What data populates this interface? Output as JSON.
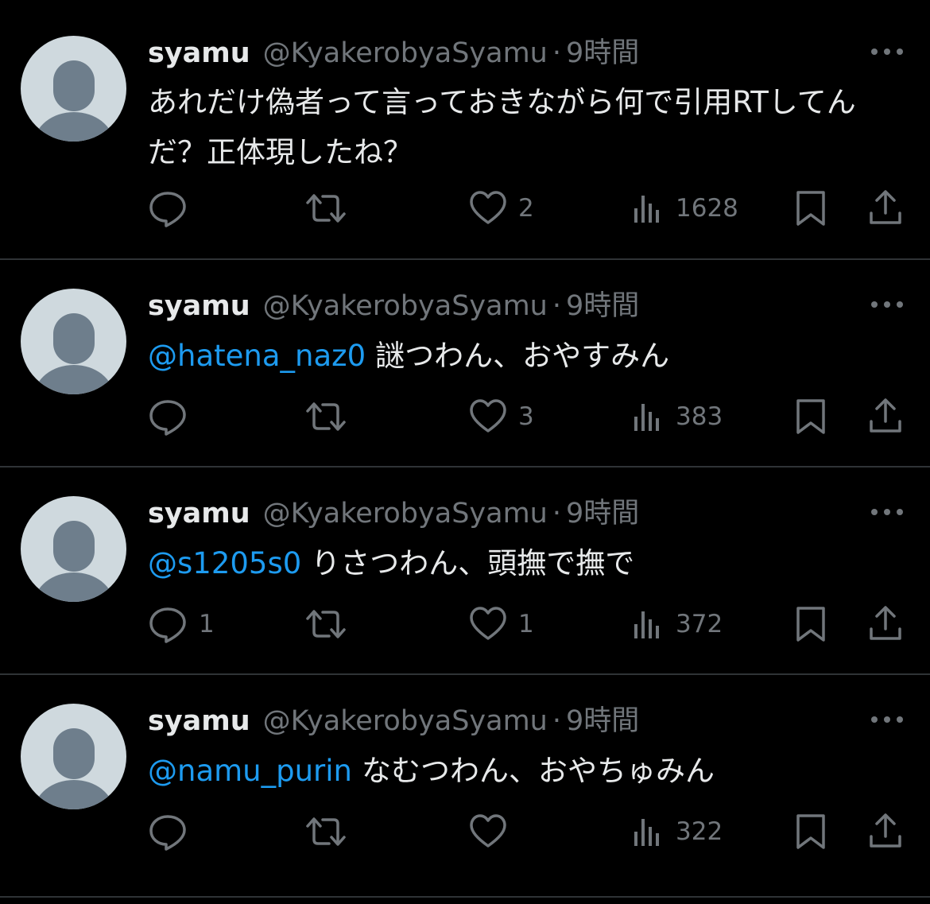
{
  "colors": {
    "background": "#000000",
    "text": "#e7e9ea",
    "muted": "#71767b",
    "mention": "#1d9bf0",
    "divider": "#2f3336",
    "avatar_bg": "#cfd9de",
    "avatar_fg": "#6e7e8c"
  },
  "icons": [
    "default-avatar-icon",
    "more-icon",
    "reply-icon",
    "retweet-icon",
    "like-icon",
    "views-icon",
    "bookmark-icon",
    "share-icon"
  ],
  "tweets": [
    {
      "name": "syamu",
      "handle": "@KyakerobyaSyamu",
      "separator": "·",
      "time": "9時間",
      "mention": "",
      "text": "あれだけ偽者って言っておきながら何で引用RTしてんだ？正体現したね？",
      "replies": "",
      "retweets": "",
      "likes": "2",
      "views": "1628"
    },
    {
      "name": "syamu",
      "handle": "@KyakerobyaSyamu",
      "separator": "·",
      "time": "9時間",
      "mention": "@hatena_naz0",
      "text": "謎つわん、おやすみん",
      "replies": "",
      "retweets": "",
      "likes": "3",
      "views": "383"
    },
    {
      "name": "syamu",
      "handle": "@KyakerobyaSyamu",
      "separator": "·",
      "time": "9時間",
      "mention": "@s1205s0",
      "text": "りさつわん、頭撫で撫で",
      "replies": "1",
      "retweets": "",
      "likes": "1",
      "views": "372"
    },
    {
      "name": "syamu",
      "handle": "@KyakerobyaSyamu",
      "separator": "·",
      "time": "9時間",
      "mention": "@namu_purin",
      "text": "なむつわん、おやちゅみん",
      "replies": "",
      "retweets": "",
      "likes": "",
      "views": "322"
    }
  ]
}
